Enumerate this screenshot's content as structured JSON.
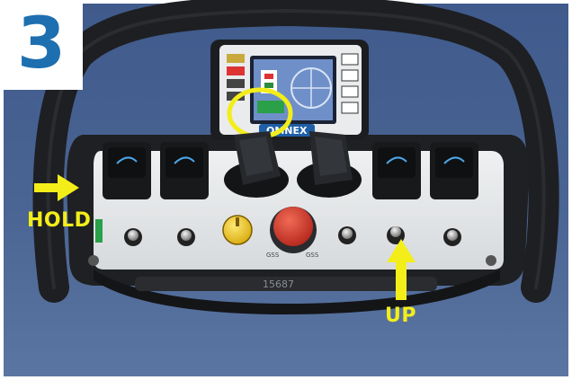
{
  "step_badge": {
    "number": "3",
    "color": "#1e6fb0"
  },
  "callouts": {
    "hold": {
      "label": "HOLD",
      "color": "#f3ee1a"
    },
    "up": {
      "label": "UP",
      "color": "#f3ee1a"
    }
  },
  "display_highlight": {
    "shape": "circle",
    "color": "#f3ee1a"
  },
  "remote": {
    "brand": "OMNEX",
    "serial": "15687",
    "emergency_stop_labels": [
      "GSS",
      "GSS"
    ]
  }
}
